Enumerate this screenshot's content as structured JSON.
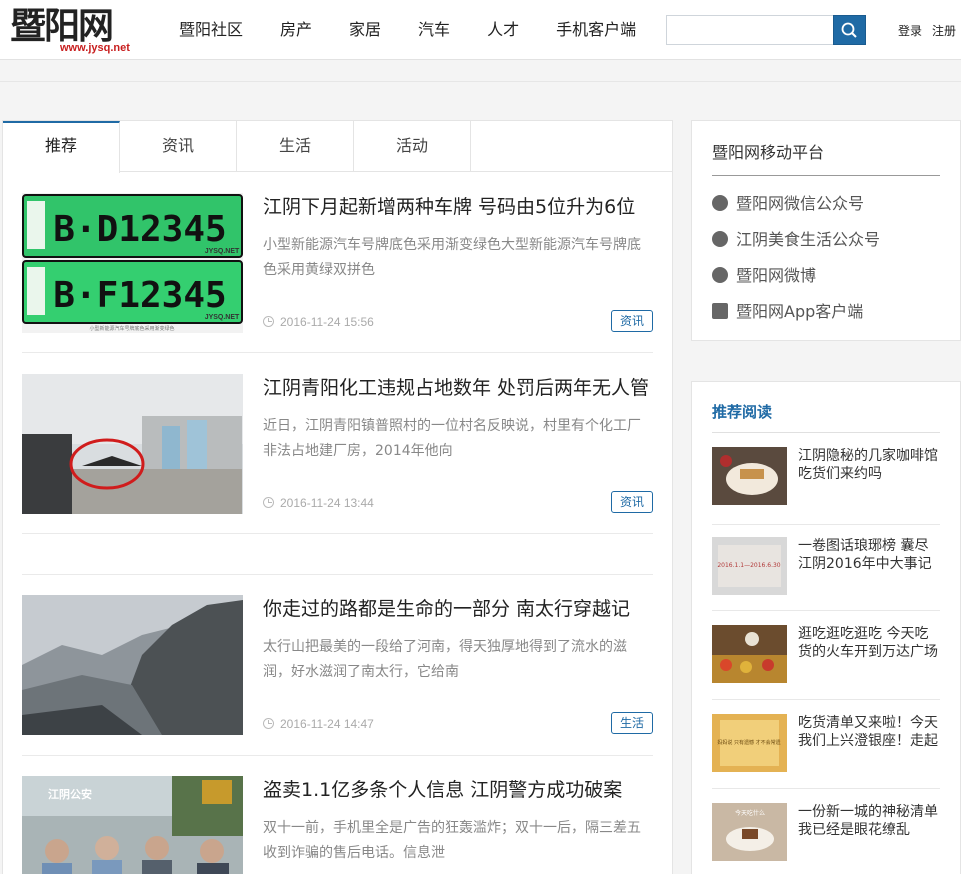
{
  "header": {
    "logo_text_a": "暨",
    "logo_text_b": "阳网",
    "logo_url": "www.jysq.net",
    "nav": [
      "暨阳社区",
      "房产",
      "家居",
      "汽车",
      "人才",
      "手机客户端"
    ],
    "search_placeholder": "",
    "login_label": "登录",
    "register_label": "注册"
  },
  "tabs": [
    {
      "label": "推荐",
      "active": true
    },
    {
      "label": "资讯",
      "active": false
    },
    {
      "label": "生活",
      "active": false
    },
    {
      "label": "活动",
      "active": false
    }
  ],
  "articles": [
    {
      "title": "江阴下月起新增两种车牌 号码由5位升为6位",
      "summary": "小型新能源汽车号牌底色采用渐变绿色大型新能源汽车号牌底色采用黄绿双拼色",
      "time": "2016-11-24 15:56",
      "tag": "资讯",
      "image": "license-plate-photo",
      "plate1": "B·D12345",
      "plate2": "B·F12345",
      "plate_watermark": "JYSQ.NET",
      "plate_caption": "小型新能源汽车号牌底色采用渐变绿色"
    },
    {
      "title": "江阴青阳化工违规占地数年 处罚后两年无人管",
      "summary": "近日，江阴青阳镇普照村的一位村名反映说，村里有个化工厂非法占地建厂房，2014年他向",
      "time": "2016-11-24 13:44",
      "tag": "资讯",
      "image": "chemical-plant-photo"
    },
    {
      "title": "你走过的路都是生命的一部分 南太行穿越记",
      "summary": "太行山把最美的一段给了河南，得天独厚地得到了流水的滋润，好水滋润了南太行，它给南",
      "time": "2016-11-24 14:47",
      "tag": "生活",
      "image": "mountain-photo"
    },
    {
      "title": "盗卖1.1亿多条个人信息 江阴警方成功破案",
      "summary": "双十一前，手机里全是广告的狂轰滥炸；双十一后，隔三差五收到诈骗的售后电话。信息泄",
      "time": "",
      "tag": "",
      "image": "police-photo",
      "image_label": "江阴公安"
    }
  ],
  "mobile_platform": {
    "title": "暨阳网移动平台",
    "items": [
      {
        "label": "暨阳网微信公众号",
        "icon": "wechat-icon"
      },
      {
        "label": "江阴美食生活公众号",
        "icon": "wechat-icon"
      },
      {
        "label": "暨阳网微博",
        "icon": "weibo-icon"
      },
      {
        "label": "暨阳网App客户端",
        "icon": "app-icon"
      }
    ]
  },
  "recommended": {
    "title": "推荐阅读",
    "items": [
      {
        "text": "江阴隐秘的几家咖啡馆 吃货们来约吗",
        "image": "coffee-photo"
      },
      {
        "text": "一卷图话琅琊榜 囊尽江阴2016年中大事记",
        "image": "poster-photo",
        "image_label": "2016.1.1—2016.6.30"
      },
      {
        "text": "逛吃逛吃逛吃 今天吃货的火车开到万达广场",
        "image": "market-photo"
      },
      {
        "text": "吃货清单又来啦！今天我们上兴澄银座！走起",
        "image": "menu-card-photo",
        "image_label": "妈妈说 只有遗憾 才不会常遗"
      },
      {
        "text": "一份新一城的神秘清单 我已经是眼花缭乱",
        "image": "dessert-photo",
        "image_label": "今天吃什么"
      }
    ]
  },
  "colors": {
    "accent": "#1f6aa5",
    "logo_red": "#c81e1e",
    "plate_green": "#2fd06a"
  }
}
